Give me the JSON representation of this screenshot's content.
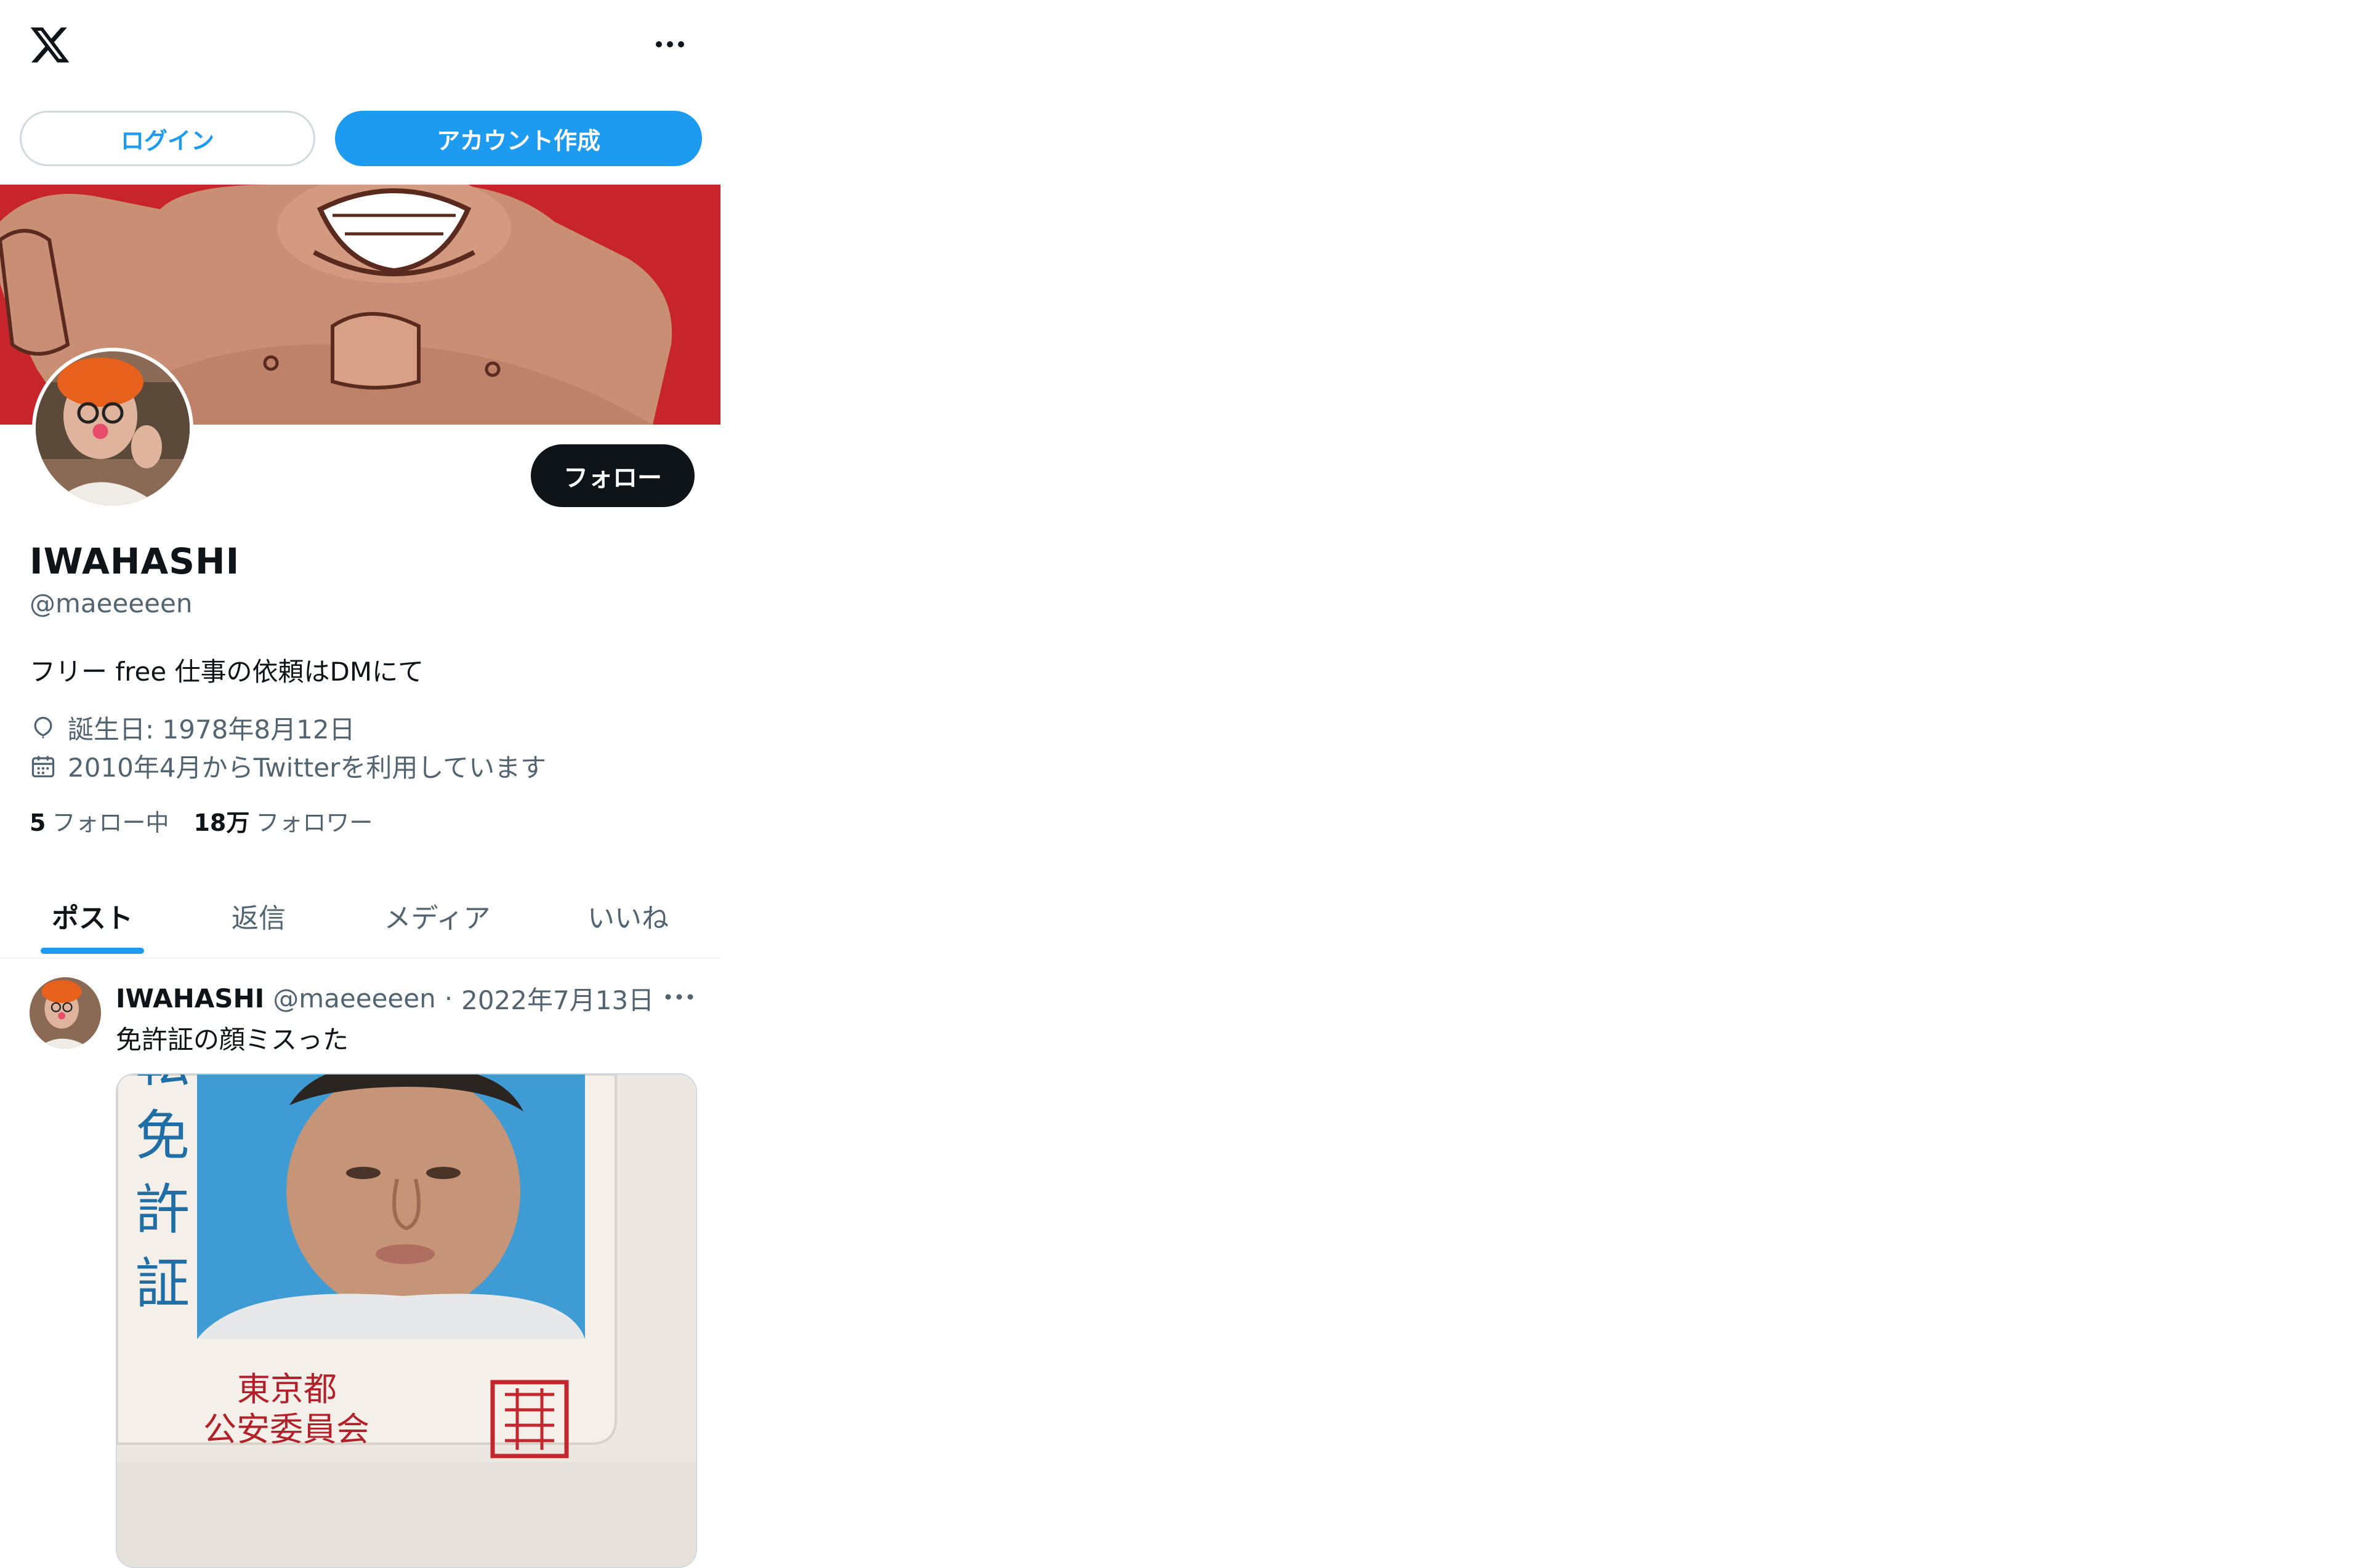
{
  "header": {
    "logo_icon": "x-logo-icon",
    "more_icon": "more-horizontal-icon",
    "login_label": "ログイン",
    "signup_label": "アカウント作成"
  },
  "profile": {
    "display_name": "IWAHASHI",
    "handle": "@maeeeeen",
    "follow_label": "フォロー",
    "bio": "フリー free 仕事の依頼はDMにて",
    "birthday": "誕生日: 1978年8月12日",
    "joined": "2010年4月からTwitterを利用しています",
    "following_count": "5",
    "following_label": "フォロー中",
    "followers_count": "18万",
    "followers_label": "フォロワー"
  },
  "tabs": [
    {
      "label": "ポスト",
      "active": true
    },
    {
      "label": "返信",
      "active": false
    },
    {
      "label": "メディア",
      "active": false
    },
    {
      "label": "いいね",
      "active": false
    }
  ],
  "post": {
    "author": "IWAHASHI",
    "handle": "@maeeeeen",
    "separator": "·",
    "date": "2022年7月13日",
    "text": "免許証の顔ミスった",
    "media": {
      "license_chars": [
        "転",
        "免",
        "許",
        "証"
      ],
      "issuer_line1": "東京都",
      "issuer_line2": "公安委員会",
      "stamp_text": "東京都公安委員会印"
    }
  },
  "colors": {
    "accent": "#1d9bf0",
    "text": "#0f1419",
    "muted": "#536471",
    "banner_red": "#c7252b"
  }
}
